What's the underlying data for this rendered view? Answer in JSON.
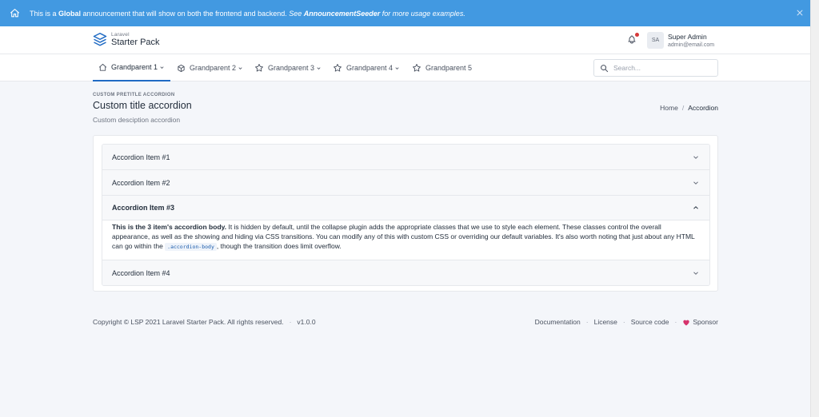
{
  "announcement": {
    "prefix": "This is a ",
    "bold": "Global",
    "text": " announcement that will show on both the frontend and backend. ",
    "see": "See ",
    "seeder": "AnnouncementSeeder",
    "suffix": " for more usage examples."
  },
  "brand": {
    "small": "Laravel",
    "big": "Starter Pack"
  },
  "user": {
    "initials": "SA",
    "name": "Super Admin",
    "email": "admin@email.com"
  },
  "nav": {
    "items": [
      {
        "label": "Grandparent 1",
        "icon": "home-icon"
      },
      {
        "label": "Grandparent 2",
        "icon": "package-icon"
      },
      {
        "label": "Grandparent 3",
        "icon": "star-icon"
      },
      {
        "label": "Grandparent 4",
        "icon": "star-icon"
      },
      {
        "label": "Grandparent 5",
        "icon": "star-icon"
      }
    ]
  },
  "search": {
    "placeholder": "Search..."
  },
  "page": {
    "pretitle": "CUSTOM PRETITLE ACCORDION",
    "title": "Custom title accordion",
    "description": "Custom desciption accordion"
  },
  "breadcrumb": {
    "home": "Home",
    "separator": "/",
    "current": "Accordion"
  },
  "accordion": {
    "items": [
      {
        "title": "Accordion Item #1"
      },
      {
        "title": "Accordion Item #2"
      },
      {
        "title": "Accordion Item #3"
      },
      {
        "title": "Accordion Item #4"
      }
    ],
    "open_body": {
      "strong": "This is the 3 item's accordion body.",
      "text1": " It is hidden by default, until the collapse plugin adds the appropriate classes that we use to style each element. These classes control the overall appearance, as well as the showing and hiding via CSS transitions. You can modify any of this with custom CSS or overriding our default variables. It's also worth noting that just about any HTML can go within the ",
      "code": ".accordion-body",
      "text2": ", though the transition does limit overflow."
    }
  },
  "footer": {
    "copyright": "Copyright © LSP 2021 Laravel Starter Pack. All rights reserved.",
    "dot": "·",
    "version": "v1.0.0",
    "links": {
      "documentation": "Documentation",
      "license": "License",
      "source": "Source code",
      "sponsor": "Sponsor"
    }
  },
  "colors": {
    "announcement_bg": "#4299e1",
    "active_nav": "#206bc4",
    "notification_dot": "#d63939",
    "heart": "#d6336c"
  }
}
